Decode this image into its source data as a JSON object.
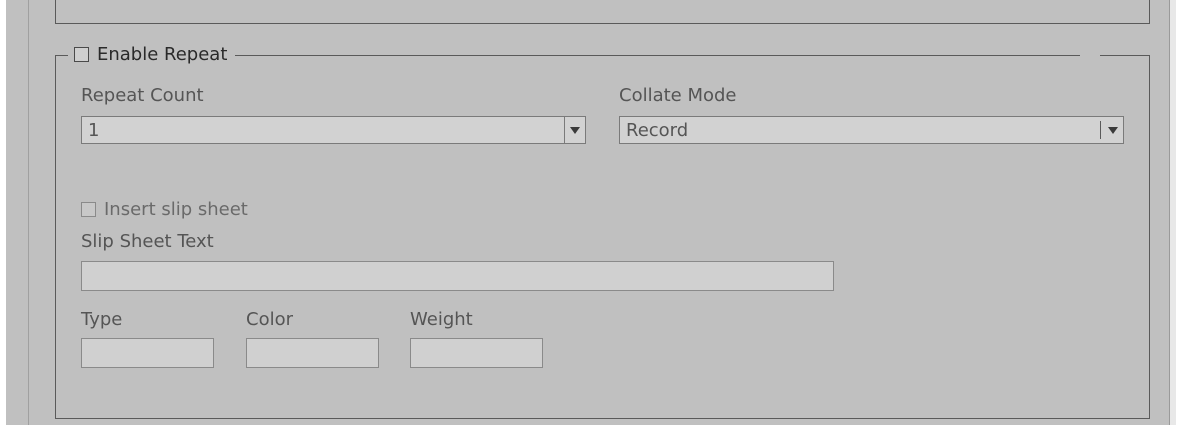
{
  "group": {
    "enable_repeat_label": "Enable Repeat",
    "enable_repeat_checked": false
  },
  "repeat_count": {
    "label": "Repeat Count",
    "value": "1"
  },
  "collate_mode": {
    "label": "Collate Mode",
    "value": "Record"
  },
  "slip_sheet": {
    "insert_label": "Insert slip sheet",
    "insert_checked": false,
    "text_label": "Slip Sheet Text",
    "text_value": ""
  },
  "font": {
    "type_label": "Type",
    "type_value": "",
    "color_label": "Color",
    "color_value": "",
    "weight_label": "Weight",
    "weight_value": ""
  },
  "icons": {
    "dropdown": "chevron-down-icon",
    "checkbox": "checkbox-icon"
  },
  "colors": {
    "background": "#c0c0c0",
    "field": "#d2d2d2",
    "border": "#5a5a5a"
  }
}
